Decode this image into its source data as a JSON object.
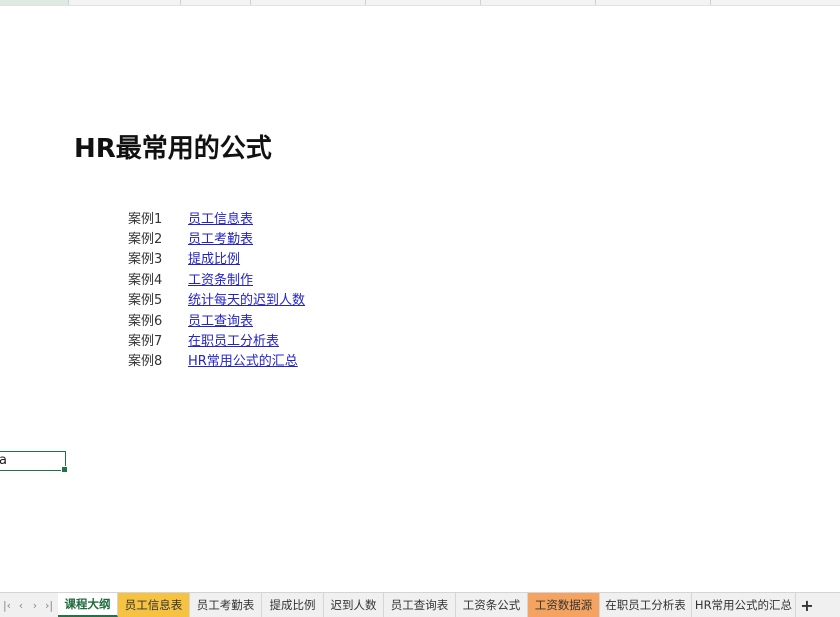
{
  "sheet": {
    "title": "HR最常用的公式",
    "cases": [
      {
        "label": "案例1",
        "link": "员工信息表"
      },
      {
        "label": "案例2",
        "link": "员工考勤表"
      },
      {
        "label": "案例3",
        "link": "提成比例"
      },
      {
        "label": "案例4",
        "link": "工资条制作"
      },
      {
        "label": "案例5",
        "link": "统计每天的迟到人数"
      },
      {
        "label": "案例6",
        "link": "员工查询表"
      },
      {
        "label": "案例7",
        "link": "在职员工分析表"
      },
      {
        "label": "案例8",
        "link": "HR常用公式的汇总"
      }
    ],
    "active_cell_value": "a"
  },
  "tabbar": {
    "nav": {
      "prev": "‹",
      "next": "›",
      "last": "›|",
      "first": "|‹"
    },
    "tabs": [
      {
        "label": "课程大纲",
        "active": true,
        "color": "#ffffff"
      },
      {
        "label": "员工信息表",
        "active": false,
        "color": "#f5c242"
      },
      {
        "label": "员工考勤表",
        "active": false,
        "color": ""
      },
      {
        "label": "提成比例",
        "active": false,
        "color": ""
      },
      {
        "label": "迟到人数",
        "active": false,
        "color": ""
      },
      {
        "label": "员工查询表",
        "active": false,
        "color": ""
      },
      {
        "label": "工资条公式",
        "active": false,
        "color": ""
      },
      {
        "label": "工资数据源",
        "active": false,
        "color": "#f4a460"
      },
      {
        "label": "在职员工分析表",
        "active": false,
        "color": ""
      },
      {
        "label": "HR常用公式的汇总",
        "active": false,
        "color": ""
      }
    ],
    "add_label": "+"
  },
  "colors": {
    "accent": "#217346",
    "link": "#2424c8",
    "tab_yellow": "#f5c242",
    "tab_orange": "#f4a460"
  }
}
